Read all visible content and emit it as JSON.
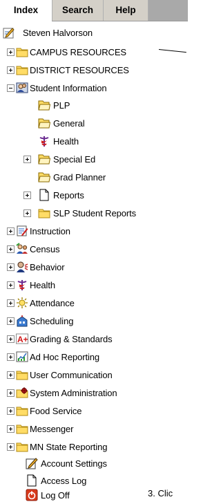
{
  "tabs": [
    "Index",
    "Search",
    "Help"
  ],
  "tree": {
    "user": "Steven Halvorson",
    "campus_resources": "CAMPUS RESOURCES",
    "district_resources": "DISTRICT RESOURCES",
    "student_information": "Student Information",
    "plp": "PLP",
    "general": "General",
    "health_sub": "Health",
    "special_ed": "Special Ed",
    "grad_planner": "Grad Planner",
    "reports": "Reports",
    "slp_reports": "SLP Student Reports",
    "instruction": "Instruction",
    "census": "Census",
    "behavior": "Behavior",
    "health": "Health",
    "attendance": "Attendance",
    "scheduling": "Scheduling",
    "grading": "Grading & Standards",
    "ad_hoc": "Ad Hoc Reporting",
    "user_comm": "User Communication",
    "system_admin": "System Administration",
    "food_service": "Food Service",
    "messenger": "Messenger",
    "mn_state": "MN State Reporting",
    "account_settings": "Account Settings",
    "access_log": "Access Log",
    "log_off": "Log Off"
  },
  "annotation": "3. Clic",
  "colors": {
    "folder_fill": "#ffdc66",
    "folder_stroke": "#b08a10",
    "tab_inactive": "#d4d0c8",
    "tab_strip": "#a9a9a9",
    "log_off_red": "#d93a1c"
  }
}
